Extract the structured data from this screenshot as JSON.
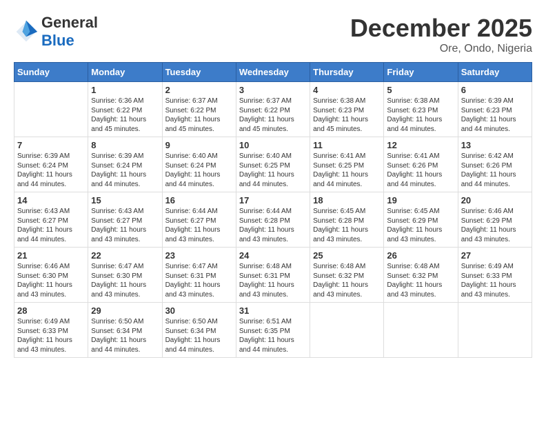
{
  "header": {
    "logo_general": "General",
    "logo_blue": "Blue",
    "month_title": "December 2025",
    "location": "Ore, Ondo, Nigeria"
  },
  "calendar": {
    "days_of_week": [
      "Sunday",
      "Monday",
      "Tuesday",
      "Wednesday",
      "Thursday",
      "Friday",
      "Saturday"
    ],
    "weeks": [
      [
        {
          "day": "",
          "info": ""
        },
        {
          "day": "1",
          "info": "Sunrise: 6:36 AM\nSunset: 6:22 PM\nDaylight: 11 hours\nand 45 minutes."
        },
        {
          "day": "2",
          "info": "Sunrise: 6:37 AM\nSunset: 6:22 PM\nDaylight: 11 hours\nand 45 minutes."
        },
        {
          "day": "3",
          "info": "Sunrise: 6:37 AM\nSunset: 6:22 PM\nDaylight: 11 hours\nand 45 minutes."
        },
        {
          "day": "4",
          "info": "Sunrise: 6:38 AM\nSunset: 6:23 PM\nDaylight: 11 hours\nand 45 minutes."
        },
        {
          "day": "5",
          "info": "Sunrise: 6:38 AM\nSunset: 6:23 PM\nDaylight: 11 hours\nand 44 minutes."
        },
        {
          "day": "6",
          "info": "Sunrise: 6:39 AM\nSunset: 6:23 PM\nDaylight: 11 hours\nand 44 minutes."
        }
      ],
      [
        {
          "day": "7",
          "info": "Sunrise: 6:39 AM\nSunset: 6:24 PM\nDaylight: 11 hours\nand 44 minutes."
        },
        {
          "day": "8",
          "info": "Sunrise: 6:39 AM\nSunset: 6:24 PM\nDaylight: 11 hours\nand 44 minutes."
        },
        {
          "day": "9",
          "info": "Sunrise: 6:40 AM\nSunset: 6:24 PM\nDaylight: 11 hours\nand 44 minutes."
        },
        {
          "day": "10",
          "info": "Sunrise: 6:40 AM\nSunset: 6:25 PM\nDaylight: 11 hours\nand 44 minutes."
        },
        {
          "day": "11",
          "info": "Sunrise: 6:41 AM\nSunset: 6:25 PM\nDaylight: 11 hours\nand 44 minutes."
        },
        {
          "day": "12",
          "info": "Sunrise: 6:41 AM\nSunset: 6:26 PM\nDaylight: 11 hours\nand 44 minutes."
        },
        {
          "day": "13",
          "info": "Sunrise: 6:42 AM\nSunset: 6:26 PM\nDaylight: 11 hours\nand 44 minutes."
        }
      ],
      [
        {
          "day": "14",
          "info": "Sunrise: 6:43 AM\nSunset: 6:27 PM\nDaylight: 11 hours\nand 44 minutes."
        },
        {
          "day": "15",
          "info": "Sunrise: 6:43 AM\nSunset: 6:27 PM\nDaylight: 11 hours\nand 43 minutes."
        },
        {
          "day": "16",
          "info": "Sunrise: 6:44 AM\nSunset: 6:27 PM\nDaylight: 11 hours\nand 43 minutes."
        },
        {
          "day": "17",
          "info": "Sunrise: 6:44 AM\nSunset: 6:28 PM\nDaylight: 11 hours\nand 43 minutes."
        },
        {
          "day": "18",
          "info": "Sunrise: 6:45 AM\nSunset: 6:28 PM\nDaylight: 11 hours\nand 43 minutes."
        },
        {
          "day": "19",
          "info": "Sunrise: 6:45 AM\nSunset: 6:29 PM\nDaylight: 11 hours\nand 43 minutes."
        },
        {
          "day": "20",
          "info": "Sunrise: 6:46 AM\nSunset: 6:29 PM\nDaylight: 11 hours\nand 43 minutes."
        }
      ],
      [
        {
          "day": "21",
          "info": "Sunrise: 6:46 AM\nSunset: 6:30 PM\nDaylight: 11 hours\nand 43 minutes."
        },
        {
          "day": "22",
          "info": "Sunrise: 6:47 AM\nSunset: 6:30 PM\nDaylight: 11 hours\nand 43 minutes."
        },
        {
          "day": "23",
          "info": "Sunrise: 6:47 AM\nSunset: 6:31 PM\nDaylight: 11 hours\nand 43 minutes."
        },
        {
          "day": "24",
          "info": "Sunrise: 6:48 AM\nSunset: 6:31 PM\nDaylight: 11 hours\nand 43 minutes."
        },
        {
          "day": "25",
          "info": "Sunrise: 6:48 AM\nSunset: 6:32 PM\nDaylight: 11 hours\nand 43 minutes."
        },
        {
          "day": "26",
          "info": "Sunrise: 6:48 AM\nSunset: 6:32 PM\nDaylight: 11 hours\nand 43 minutes."
        },
        {
          "day": "27",
          "info": "Sunrise: 6:49 AM\nSunset: 6:33 PM\nDaylight: 11 hours\nand 43 minutes."
        }
      ],
      [
        {
          "day": "28",
          "info": "Sunrise: 6:49 AM\nSunset: 6:33 PM\nDaylight: 11 hours\nand 43 minutes."
        },
        {
          "day": "29",
          "info": "Sunrise: 6:50 AM\nSunset: 6:34 PM\nDaylight: 11 hours\nand 44 minutes."
        },
        {
          "day": "30",
          "info": "Sunrise: 6:50 AM\nSunset: 6:34 PM\nDaylight: 11 hours\nand 44 minutes."
        },
        {
          "day": "31",
          "info": "Sunrise: 6:51 AM\nSunset: 6:35 PM\nDaylight: 11 hours\nand 44 minutes."
        },
        {
          "day": "",
          "info": ""
        },
        {
          "day": "",
          "info": ""
        },
        {
          "day": "",
          "info": ""
        }
      ]
    ]
  }
}
